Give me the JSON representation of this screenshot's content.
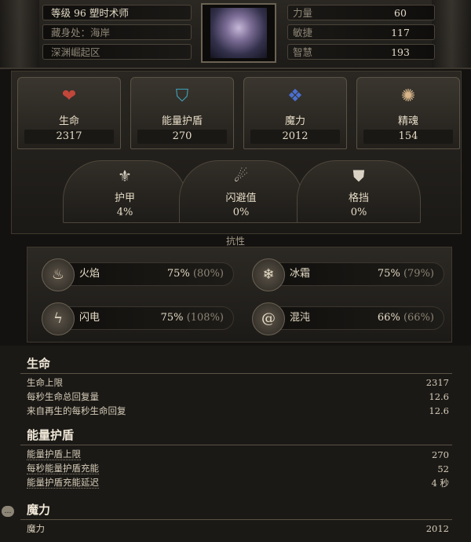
{
  "header": {
    "level_class": "等级 96 塑时术师",
    "hideout": "藏身处：海岸",
    "zone": "深渊崛起区",
    "attributes": [
      {
        "label": "力量",
        "value": "60"
      },
      {
        "label": "敏捷",
        "value": "117"
      },
      {
        "label": "智慧",
        "value": "193"
      }
    ]
  },
  "main_stats": [
    {
      "name": "生命",
      "value": "2317",
      "icon": "heart-icon",
      "color": "#c0473a"
    },
    {
      "name": "能量护盾",
      "value": "270",
      "icon": "shield-icon",
      "color": "#3fa0b8"
    },
    {
      "name": "魔力",
      "value": "2012",
      "icon": "mana-icon",
      "color": "#4a6fcf"
    },
    {
      "name": "精魂",
      "value": "154",
      "icon": "spirit-icon",
      "color": "#d8b68a"
    }
  ],
  "defences": [
    {
      "name": "护甲",
      "value": "4%",
      "icon": "armour-icon"
    },
    {
      "name": "闪避值",
      "value": "0%",
      "icon": "evasion-icon"
    },
    {
      "name": "格挡",
      "value": "0%",
      "icon": "block-icon"
    }
  ],
  "resistances": {
    "title": "抗性",
    "items": [
      {
        "name": "火焰",
        "value": "75%",
        "max": "(80%)",
        "icon": "fire-icon"
      },
      {
        "name": "冰霜",
        "value": "75%",
        "max": "(79%)",
        "icon": "cold-icon"
      },
      {
        "name": "闪电",
        "value": "75%",
        "max": "(108%)",
        "icon": "lightning-icon"
      },
      {
        "name": "混沌",
        "value": "66%",
        "max": "(66%)",
        "icon": "chaos-icon"
      }
    ]
  },
  "details": {
    "life": {
      "title": "生命",
      "rows": [
        {
          "label": "生命上限",
          "value": "2317"
        },
        {
          "label": "每秒生命总回复量",
          "value": "12.6"
        },
        {
          "label": "来自再生的每秒生命回复",
          "value": "12.6"
        }
      ]
    },
    "es": {
      "title": "能量护盾",
      "rows": [
        {
          "label": "能量护盾上限",
          "value": "270"
        },
        {
          "label": "每秒能量护盾充能",
          "value": "52"
        },
        {
          "label": "能量护盾充能延迟",
          "value": "4 秒"
        }
      ]
    },
    "mana": {
      "title": "魔力",
      "rows": [
        {
          "label": "魔力",
          "value": "2012"
        }
      ]
    }
  }
}
